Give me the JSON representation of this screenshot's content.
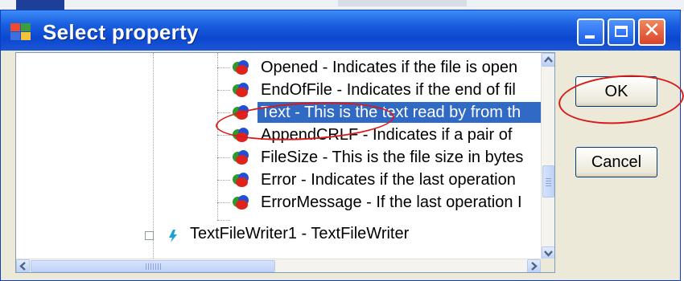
{
  "window": {
    "title": "Select property"
  },
  "tree": {
    "items": [
      {
        "label": "Opened - Indicates if the file is open"
      },
      {
        "label": "EndOfFile - Indicates if the end of fil"
      },
      {
        "label": "Text - This is the text read by from th",
        "selected": true
      },
      {
        "label": "AppendCRLF - Indicates if a pair of"
      },
      {
        "label": "FileSize - This is the file size in bytes"
      },
      {
        "label": "Error - Indicates if the last operation"
      },
      {
        "label": "ErrorMessage - If the last operation I"
      }
    ],
    "partial_item": "TextFileWriter1 - TextFileWriter",
    "partial_icon": "text-writer-icon"
  },
  "buttons": {
    "ok": "OK",
    "cancel": "Cancel"
  },
  "colors": {
    "selection": "#316ac5",
    "annotation": "#d81a1a",
    "titlebar": "#0b47cf"
  },
  "icons": {
    "app": "select-property-app-icon",
    "item": "property-icon"
  }
}
